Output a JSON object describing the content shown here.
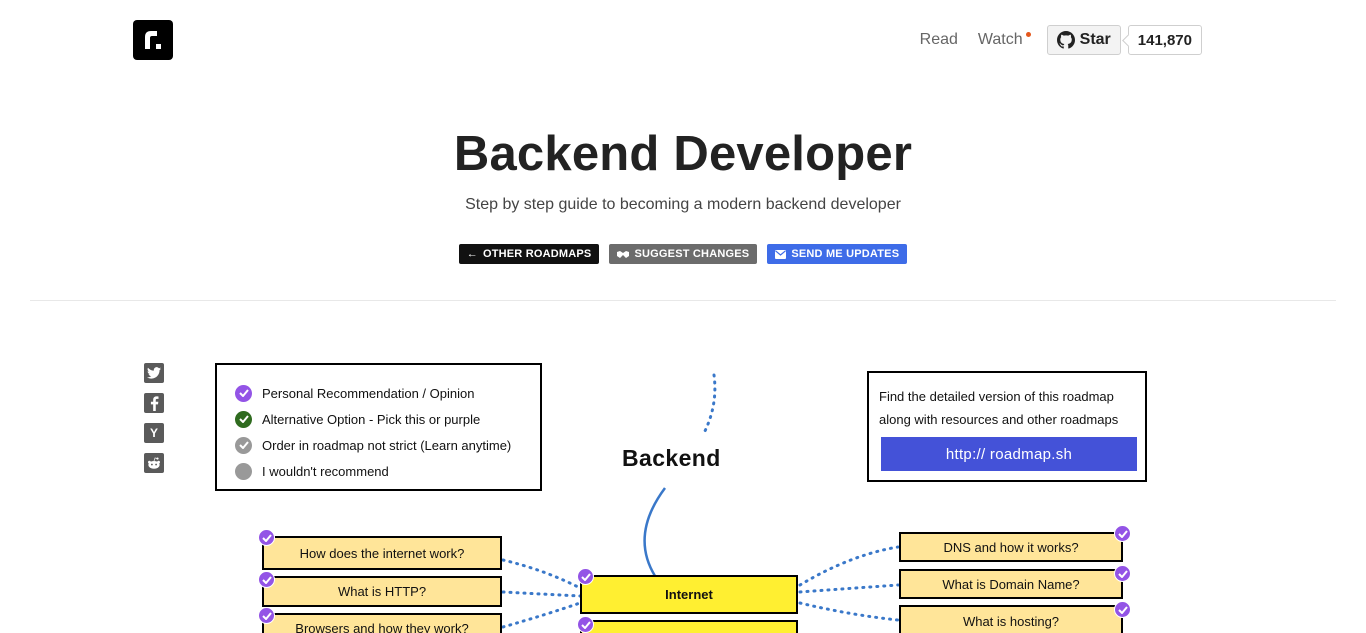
{
  "header": {
    "logo_alt": "roadmap.sh",
    "nav": {
      "read": "Read",
      "watch": "Watch"
    },
    "github": {
      "star_label": "Star",
      "star_count": "141,870"
    }
  },
  "hero": {
    "title": "Backend Developer",
    "subtitle": "Step by step guide to becoming a modern backend developer",
    "buttons": {
      "other_roadmaps": "OTHER ROADMAPS",
      "suggest_changes": "SUGGEST CHANGES",
      "send_updates": "SEND ME UPDATES"
    }
  },
  "share": {
    "icons": [
      "twitter-icon",
      "facebook-icon",
      "hackernews-icon",
      "reddit-icon"
    ],
    "hackernews_letter": "Y"
  },
  "roadmap": {
    "legend": {
      "items": [
        {
          "label": "Personal Recommendation / Opinion",
          "color": "#9354e6",
          "checked": true
        },
        {
          "label": "Alternative Option - Pick this or purple",
          "color": "#2f6b1f",
          "checked": true
        },
        {
          "label": "Order in roadmap not strict (Learn anytime)",
          "color": "#999999",
          "checked": true
        },
        {
          "label": "I wouldn't recommend",
          "color": "#999999",
          "checked": false
        }
      ]
    },
    "info": {
      "line1": "Find the detailed version of this roadmap",
      "line2": "along with resources and other roadmaps",
      "link": "http:// roadmap.sh"
    },
    "root_label": "Backend",
    "main_node": "Internet",
    "left_nodes": [
      "How does the internet work?",
      "What is HTTP?",
      "Browsers and how they work?"
    ],
    "right_nodes": [
      "DNS and how it works?",
      "What is Domain Name?",
      "What is hosting?"
    ]
  },
  "colors": {
    "accent_purple": "#9354e6",
    "node_fill": "#ffe599",
    "main_node_fill": "#ffef31",
    "link_blue": "#4452d8",
    "send_updates_blue": "#3e6ce8",
    "connector_blue": "#3a78c9"
  }
}
